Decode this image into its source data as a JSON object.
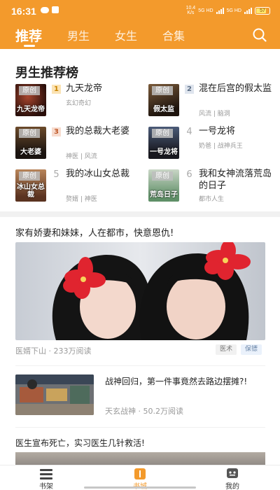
{
  "status_bar": {
    "time": "16:31",
    "network_top": "10.4",
    "network_bottom": "K/s",
    "signal_1": "5G HD",
    "signal_2": "5G HD",
    "battery": "57"
  },
  "header": {
    "tabs": [
      {
        "label": "推荐",
        "active": true
      },
      {
        "label": "男生",
        "active": false
      },
      {
        "label": "女生",
        "active": false
      },
      {
        "label": "合集",
        "active": false
      }
    ],
    "search_icon": "search-icon"
  },
  "ranking": {
    "title": "男生推荐榜",
    "cover_tag": "原创",
    "books": [
      {
        "rank": "1",
        "title": "九天龙帝",
        "meta": "玄幻奇幻",
        "cover_text": "九天龙帝"
      },
      {
        "rank": "2",
        "title": "混在后宫的假太监",
        "meta": "风流 | 脑洞",
        "cover_text": "假太监"
      },
      {
        "rank": "3",
        "title": "我的总裁大老婆",
        "meta": "神医 | 风流",
        "cover_text": "大老婆"
      },
      {
        "rank": "4",
        "title": "一号龙将",
        "meta": "奶爸 | 战神兵王",
        "cover_text": "一号龙将"
      },
      {
        "rank": "5",
        "title": "我的冰山女总裁",
        "meta": "赘婿 | 神医",
        "cover_text": "冰山女总裁"
      },
      {
        "rank": "6",
        "title": "我和女神流落荒岛的日子",
        "meta": "都市人生",
        "cover_text": "荒岛日子"
      }
    ]
  },
  "feed": [
    {
      "title": "家有娇妻和妹妹，人在都市，快意恩仇!",
      "source": "医婿下山",
      "reads": "233万阅读",
      "tags": [
        "医术",
        "保镖"
      ]
    },
    {
      "title": "战神回归，第一件事竟然去路边摆摊?!",
      "source": "天玄战神",
      "reads": "50.2万阅读"
    },
    {
      "title": "医生宣布死亡，实习医生几针救活!"
    }
  ],
  "bottom_nav": [
    {
      "label": "书架",
      "icon": "bookshelf-icon"
    },
    {
      "label": "书城",
      "icon": "bookstore-icon",
      "active": true
    },
    {
      "label": "我的",
      "icon": "profile-icon"
    }
  ],
  "colors": {
    "accent": "#f39a2c",
    "text": "#222222",
    "muted": "#999999"
  }
}
